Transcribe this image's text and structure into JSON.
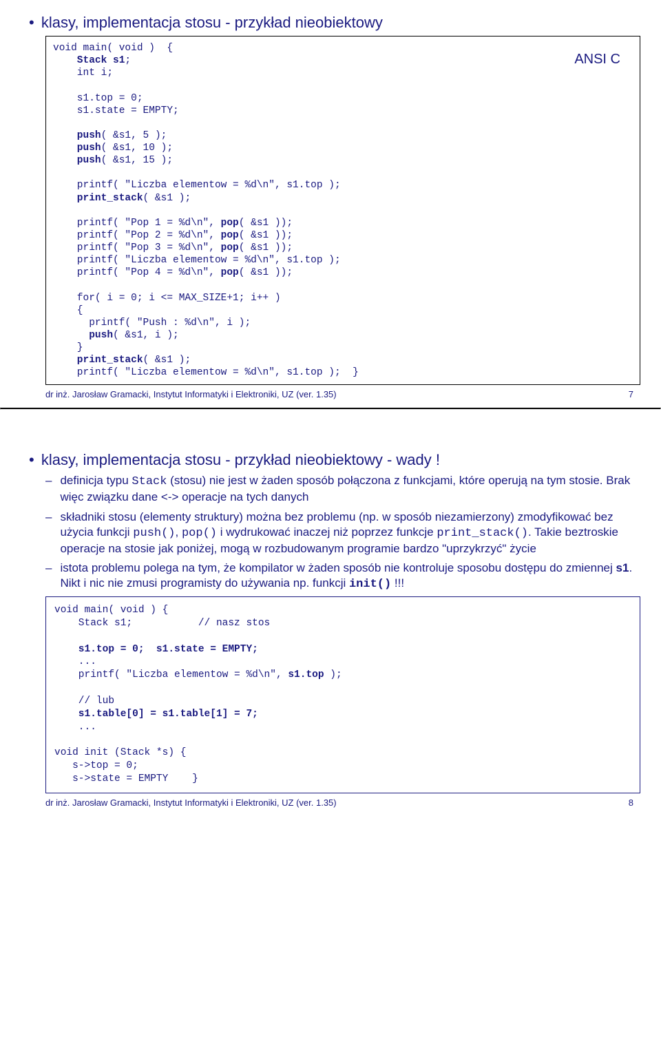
{
  "slide1": {
    "heading": "klasy, implementacja stosu  - przykład nieobiektowy",
    "ansic": "ANSI  C",
    "code": {
      "l1": "void main( void )  {",
      "l2a": "    Stack s1",
      "l2b": ";",
      "l3": "    int i;",
      "l4": "    s1.top = 0;",
      "l5": "    s1.state = EMPTY;",
      "l6a": "    push",
      "l6b": "( &s1, 5 );",
      "l7a": "    push",
      "l7b": "( &s1, 10 );",
      "l8a": "    push",
      "l8b": "( &s1, 15 );",
      "l9": "    printf( \"Liczba elementow = %d\\n\", s1.top );",
      "l10a": "    print_stack",
      "l10b": "( &s1 );",
      "l11a": "    printf( \"Pop 1 = %d\\n\", ",
      "l11b": "pop",
      "l11c": "( &s1 ));",
      "l12a": "    printf( \"Pop 2 = %d\\n\", ",
      "l12b": "pop",
      "l12c": "( &s1 ));",
      "l13a": "    printf( \"Pop 3 = %d\\n\", ",
      "l13b": "pop",
      "l13c": "( &s1 ));",
      "l14": "    printf( \"Liczba elementow = %d\\n\", s1.top );",
      "l15a": "    printf( \"Pop 4 = %d\\n\", ",
      "l15b": "pop",
      "l15c": "( &s1 ));",
      "l16": "    for( i = 0; i <= MAX_SIZE+1; i++ )",
      "l17": "    {",
      "l18": "      printf( \"Push : %d\\n\", i );",
      "l19a": "      push",
      "l19b": "( &s1, i );",
      "l20": "    }",
      "l21a": "    print_stack",
      "l21b": "( &s1 );",
      "l22": "    printf( \"Liczba elementow = %d\\n\", s1.top );  }"
    },
    "footer_left": "dr inż. Jarosław Gramacki, Instytut Informatyki i Elektroniki, UZ (ver. 1.35)",
    "footer_right": "7"
  },
  "slide2": {
    "heading": "klasy, implementacja stosu  - przykład nieobiektowy - wady !",
    "b1a": "definicja typu ",
    "b1_code": "Stack",
    "b1b": " (stosu) nie jest w żaden sposób połączona z funkcjami, które operują na tym stosie. Brak więc związku dane <-> operacje na tych danych",
    "b2a": "składniki stosu (elementy struktury) można bez problemu (np. w sposób niezamierzony) zmodyfikować bez użycia funkcji ",
    "b2_c1": "push()",
    "b2_c2": ", ",
    "b2_c3": "pop()",
    "b2b": " i wydrukować inaczej niż poprzez funkcje ",
    "b2_c4": "print_stack()",
    "b2c": ". Takie beztroskie operacje na stosie jak poniżej, mogą w rozbudowanym programie bardzo \"uprzykrzyć\" życie",
    "b3a": "istota problemu polega na tym, że kompilator w żaden sposób nie kontroluje sposobu dostępu do zmiennej ",
    "b3_s1": "s1",
    "b3b": ". Nikt i nic nie zmusi programisty do używania np. funkcji ",
    "b3_c1": "init()",
    "b3c": " !!!",
    "code": {
      "l1": "void main( void ) {",
      "l2": "    Stack s1;           // nasz stos",
      "l3": "    s1.top = 0;  s1.state = EMPTY;",
      "l4": "    ...",
      "l5a": "    printf( \"Liczba elementow = %d\\n\", ",
      "l5b": "s1.top",
      "l5c": " );",
      "l6": "    // lub",
      "l7": "    s1.table[0] = s1.table[1] = 7;",
      "l8": "    ...",
      "l9": "void init (Stack *s) {",
      "l10": "   s->top = 0;",
      "l11": "   s->state = EMPTY    }"
    },
    "footer_left": "dr inż. Jarosław Gramacki, Instytut Informatyki i Elektroniki, UZ (ver. 1.35)",
    "footer_right": "8"
  }
}
